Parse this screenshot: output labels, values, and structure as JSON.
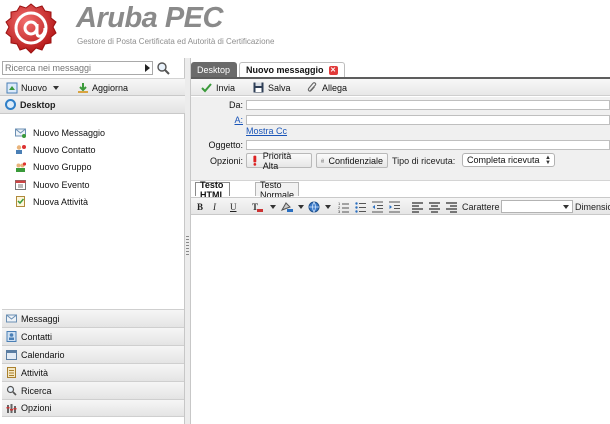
{
  "header": {
    "brand_title": "Aruba PEC",
    "brand_subtitle": "Gestore di Posta Certificata ed Autorità di Certificazione",
    "brand_color": "#d52b2b"
  },
  "sidebar": {
    "search": {
      "placeholder": "Ricerca nei messaggi"
    },
    "toolbar": {
      "new_label": "Nuovo",
      "refresh_label": "Aggiorna"
    },
    "section_title": "Desktop",
    "quick_actions": [
      {
        "label": "Nuovo Messaggio",
        "icon": "new-message-icon"
      },
      {
        "label": "Nuovo Contatto",
        "icon": "new-contact-icon"
      },
      {
        "label": "Nuovo Gruppo",
        "icon": "new-group-icon"
      },
      {
        "label": "Nuovo Evento",
        "icon": "new-event-icon"
      },
      {
        "label": "Nuova Attività",
        "icon": "new-task-icon"
      }
    ],
    "nav": [
      {
        "label": "Messaggi",
        "icon": "envelope-icon"
      },
      {
        "label": "Contatti",
        "icon": "contacts-icon"
      },
      {
        "label": "Calendario",
        "icon": "calendar-icon"
      },
      {
        "label": "Attività",
        "icon": "tasks-icon"
      },
      {
        "label": "Ricerca",
        "icon": "search-icon"
      },
      {
        "label": "Opzioni",
        "icon": "options-icon"
      }
    ]
  },
  "tabs": {
    "desktop": "Desktop",
    "compose": "Nuovo messaggio"
  },
  "compose_toolbar": {
    "send": "Invia",
    "save": "Salva",
    "attach": "Allega"
  },
  "form": {
    "from_label": "Da:",
    "to_label": "A:",
    "show_cc": "Mostra Cc",
    "subject_label": "Oggetto:",
    "options_label": "Opzioni:",
    "priority_button": "Priorità Alta",
    "confidential_button": "Confidenziale",
    "receipt_label": "Tipo di ricevuta:",
    "receipt_value": "Completa ricevuta"
  },
  "editor": {
    "tab_html": "Testo HTML",
    "tab_plain": "Testo Normale",
    "bold": "B",
    "italic": "I",
    "underline": "U",
    "font_label": "Carattere",
    "size_label": "Dimensio"
  }
}
